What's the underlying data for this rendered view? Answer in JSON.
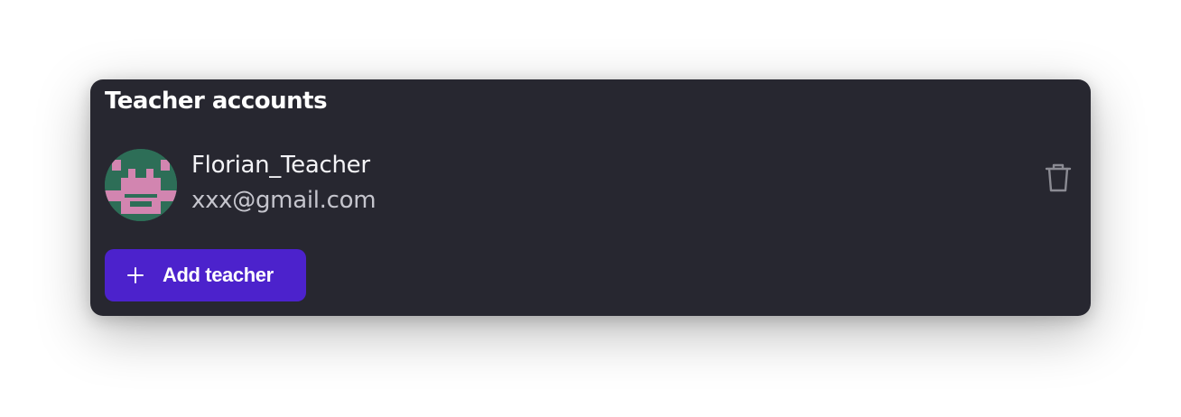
{
  "panel": {
    "title": "Teacher accounts",
    "background": "#272730"
  },
  "teachers": [
    {
      "name": "Florian_Teacher",
      "email": "xxx@gmail.com",
      "avatar_icon": "pixel-monster-avatar",
      "avatar_colors": {
        "background": "#2d6e57",
        "figure": "#d285b0"
      },
      "delete_icon": "trash-icon"
    }
  ],
  "actions": {
    "add_teacher_label": "Add teacher",
    "add_teacher_icon": "plus-icon",
    "accent": "#4c22cc"
  }
}
